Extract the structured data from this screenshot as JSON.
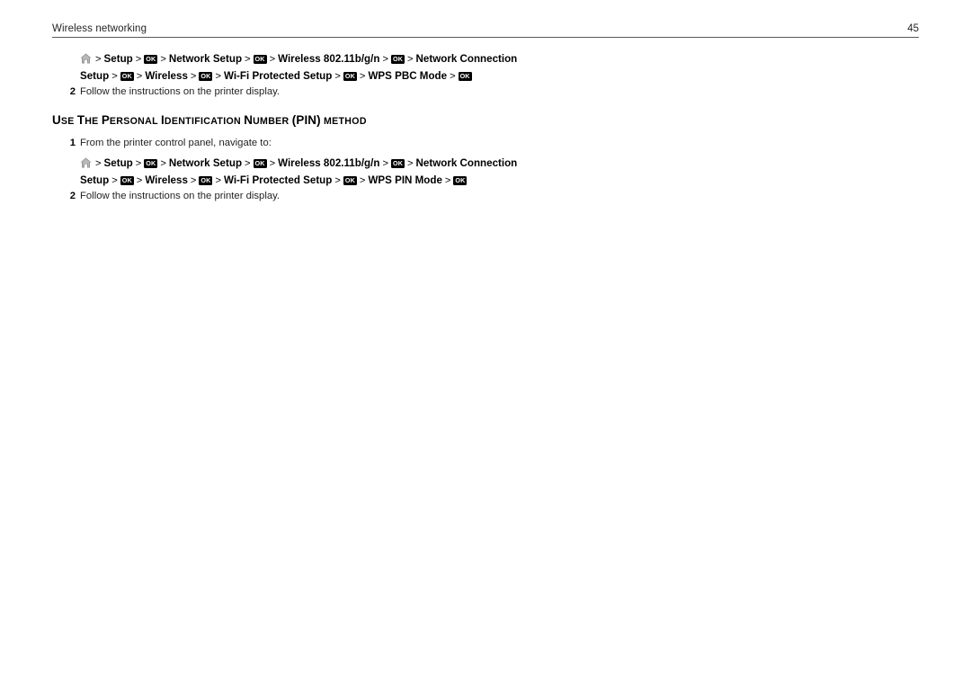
{
  "header": {
    "title": "Wireless networking",
    "page_number": "45"
  },
  "icons": {
    "home": "home-icon",
    "ok_key_label": "OK"
  },
  "separator": ">",
  "blocks": [
    {
      "id": "pbc-path",
      "nav_lines": [
        {
          "items": [
            {
              "type": "icon",
              "name": "home-icon"
            },
            {
              "type": "text",
              "value": "Setup"
            },
            {
              "type": "key",
              "value": "OK"
            },
            {
              "type": "text",
              "value": "Network Setup"
            },
            {
              "type": "key",
              "value": "OK"
            },
            {
              "type": "text",
              "value": "Wireless 802.11b/g/n"
            },
            {
              "type": "key",
              "value": "OK"
            },
            {
              "type": "text",
              "value": "Network Connection"
            }
          ]
        },
        {
          "items": [
            {
              "type": "text",
              "value": "Setup"
            },
            {
              "type": "key",
              "value": "OK"
            },
            {
              "type": "text",
              "value": "Wireless"
            },
            {
              "type": "key",
              "value": "OK"
            },
            {
              "type": "text",
              "value": "Wi-Fi Protected Setup"
            },
            {
              "type": "key",
              "value": "OK"
            },
            {
              "type": "text",
              "value": "WPS PBC Mode"
            },
            {
              "type": "key",
              "value": "OK"
            }
          ]
        }
      ]
    },
    {
      "id": "pin-path",
      "nav_lines": [
        {
          "items": [
            {
              "type": "icon",
              "name": "home-icon"
            },
            {
              "type": "text",
              "value": "Setup"
            },
            {
              "type": "key",
              "value": "OK"
            },
            {
              "type": "text",
              "value": "Network Setup"
            },
            {
              "type": "key",
              "value": "OK"
            },
            {
              "type": "text",
              "value": "Wireless 802.11b/g/n"
            },
            {
              "type": "key",
              "value": "OK"
            },
            {
              "type": "text",
              "value": "Network Connection"
            }
          ]
        },
        {
          "items": [
            {
              "type": "text",
              "value": "Setup"
            },
            {
              "type": "key",
              "value": "OK"
            },
            {
              "type": "text",
              "value": "Wireless"
            },
            {
              "type": "key",
              "value": "OK"
            },
            {
              "type": "text",
              "value": "Wi-Fi Protected Setup"
            },
            {
              "type": "key",
              "value": "OK"
            },
            {
              "type": "text",
              "value": "WPS PIN Mode"
            },
            {
              "type": "key",
              "value": "OK"
            }
          ]
        }
      ]
    }
  ],
  "steps": {
    "pbc_step2_num": "2",
    "pbc_step2_text": "Follow the instructions on the printer display.",
    "pin_step1_num": "1",
    "pin_step1_text": "From the printer control panel, navigate to:",
    "pin_step2_num": "2",
    "pin_step2_text": "Follow the instructions on the printer display."
  },
  "section_heading": {
    "parts": [
      {
        "text": "U",
        "style": "cap"
      },
      {
        "text": "SE",
        "style": "sc"
      },
      {
        "text": " ",
        "style": "sc"
      },
      {
        "text": "T",
        "style": "cap"
      },
      {
        "text": "HE",
        "style": "sc"
      },
      {
        "text": " ",
        "style": "sc"
      },
      {
        "text": "P",
        "style": "cap"
      },
      {
        "text": "ERSONAL",
        "style": "sc"
      },
      {
        "text": " ",
        "style": "sc"
      },
      {
        "text": "I",
        "style": "cap"
      },
      {
        "text": "DENTIFICATION",
        "style": "sc"
      },
      {
        "text": " ",
        "style": "sc"
      },
      {
        "text": "N",
        "style": "cap"
      },
      {
        "text": "UMBER",
        "style": "sc"
      },
      {
        "text": " ",
        "style": "sc"
      },
      {
        "text": "(PIN)",
        "style": "cap"
      },
      {
        "text": " ",
        "style": "sc"
      },
      {
        "text": "METHOD",
        "style": "sc"
      }
    ],
    "plain_text": "Use the Personal Identification Number (PIN) method"
  }
}
